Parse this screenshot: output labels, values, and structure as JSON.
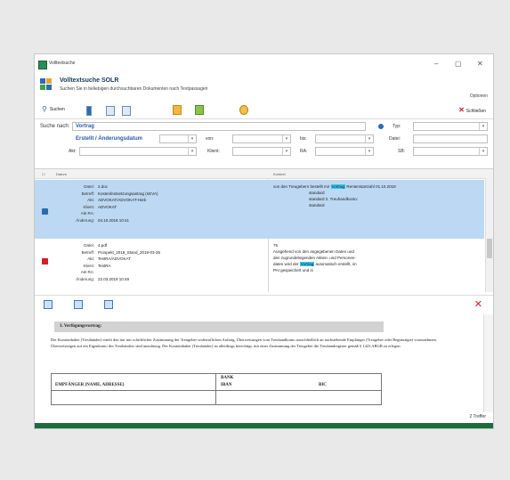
{
  "window": {
    "title": "Volltextsuche",
    "min": "–",
    "max": "▢",
    "close": "✕"
  },
  "header": {
    "title": "Volltextsuche SOLR",
    "subtitle": "Suchen Sie in beliebigen durchsuchbaren Dokumenten nach Textpassagen",
    "options": "Optionen"
  },
  "toolbar": {
    "search_label": "Suchen",
    "close_label": "Schließen",
    "close_glyph": "✕"
  },
  "form": {
    "search_label": "Suche nach:",
    "search_value": "Vortrag",
    "type_label": "Typ:",
    "date_select": "Erstellt / Änderungsdatum",
    "from_label": "von:",
    "to_label": "bis:",
    "file_label": "Datei:",
    "role_label": "Akt:",
    "client_label": "Klient:",
    "ra_label": "RA:",
    "sb_label": "SB:"
  },
  "grid": {
    "col_date": "Datum",
    "col_context": "Kontext",
    "rows": [
      {
        "fields": [
          {
            "k": "Datei:",
            "v": "2.doc"
          },
          {
            "k": "Betreff:",
            "v": "Kostenfestsetzungsantrag (nEVA)"
          },
          {
            "k": "Akt:",
            "v": "ADVOKAT/ADVOKAT-Hieb"
          },
          {
            "k": "Klient:",
            "v": "ADVOKAT"
          },
          {
            "k": "Akt RA:",
            "v": ""
          },
          {
            "k": "Änderung:",
            "v": "04.10.2018 10:41"
          }
        ],
        "snippet_pre": "von den Treugebern bestellt mir ",
        "snippet_hl": "Vortrag",
        "snippet_post": "     Rentenstartzahl 01.10.2018",
        "snippet_lines": [
          "standard",
          "standard 2.  Treuhandkonto:",
          "standard"
        ]
      },
      {
        "fields": [
          {
            "k": "Datei:",
            "v": "4.pdf"
          },
          {
            "k": "Betreff:",
            "v": "Prospekt_2019_Stand_2019-03-26"
          },
          {
            "k": "Akt:",
            "v": "TestRA/ADVOKAT"
          },
          {
            "k": "Klient:",
            "v": "TestRA"
          },
          {
            "k": "Akt RA:",
            "v": ""
          },
          {
            "k": "Änderung:",
            "v": "22.03.2019 10:49"
          }
        ],
        "snippet_lines2": [
          "75",
          "Ausgehend von den angegebenen Daten und",
          "den zugrundeliegenden Aktien- und Personen-"
        ],
        "snippet2_pre": "daten wird der ",
        "snippet2_hl": "Vortrag",
        "snippet2_post": " automatisch erstellt, im",
        "snippet2_end": "PAI gespeichert und in"
      }
    ]
  },
  "preview": {
    "close_glyph": "✕",
    "section_title": "3.   Verfügungsvortrag:",
    "body": "Der Kontoinhaber (Treuhänder) erteilt den nur mit schriftlicher Zustimmung der Treugeber widerruflichen Auftrag, Überweisungen vom Treuhandkonto ausschließlich an nachstehende Empfänger (Treugeber oder Begünstigte) vorzunehmen. Überweisungen auf ein Eigenkonto des Treuhänders sind unzulässig. Der Kontoinhaber (Treuhänder) ist allerdings berechtigt, mit einer Zustimmung der Treugeber die Treuhandregister gemäß § 1423 ABGB zu erlegen.",
    "table_col1": "EMPFÄNGER (NAME, ADRESSE)",
    "table_col2a": "BANK",
    "table_col2b": "IBAN",
    "table_col3": "BIC"
  },
  "status": {
    "hits": "2 Treffer"
  }
}
